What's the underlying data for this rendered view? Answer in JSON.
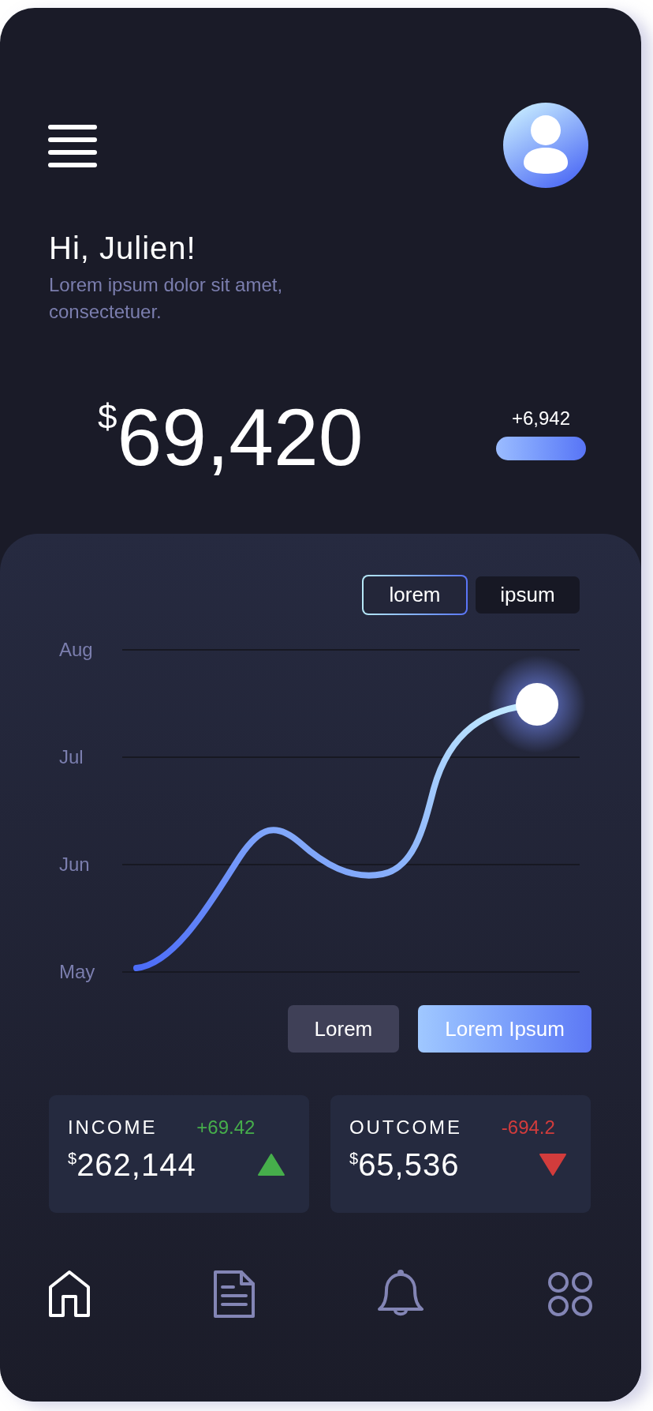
{
  "header": {
    "greeting": "Hi, Julien!",
    "subtitle": "Lorem ipsum dolor sit amet, consectetuer."
  },
  "balance": {
    "currency": "$",
    "amount": "69,420",
    "change": "+6,942"
  },
  "chart": {
    "tabs": [
      {
        "label": "lorem",
        "selected": true
      },
      {
        "label": "ipsum",
        "selected": false
      }
    ],
    "y_labels": [
      "Aug",
      "Jul",
      "Jun",
      "May"
    ],
    "buttons": [
      {
        "label": "Lorem",
        "selected": false
      },
      {
        "label": "Lorem Ipsum",
        "selected": true
      }
    ]
  },
  "cards": [
    {
      "title": "INCOME",
      "change": "+69.42",
      "currency": "$",
      "amount": "262,144",
      "kind": "up"
    },
    {
      "title": "OUTCOME",
      "change": "-694.2",
      "currency": "$",
      "amount": "65,536",
      "kind": "down"
    }
  ],
  "nav": [
    {
      "kind": "home",
      "selected": true
    },
    {
      "kind": "document",
      "selected": false
    },
    {
      "kind": "bell",
      "selected": false
    },
    {
      "kind": "apps",
      "selected": false
    }
  ]
}
